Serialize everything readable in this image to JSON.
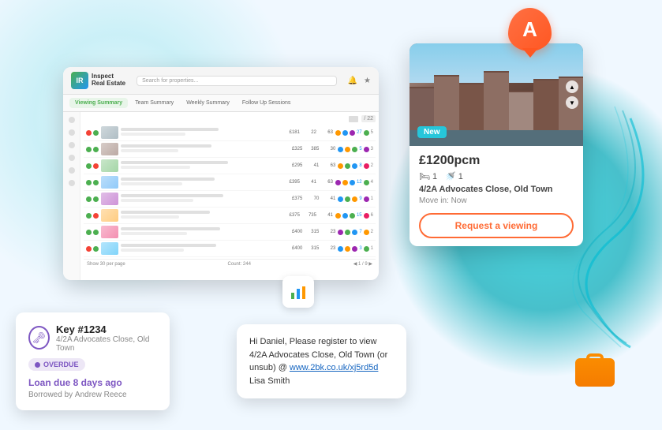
{
  "app": {
    "title": "Inspect Real Estate",
    "search_placeholder": "Search for properties..."
  },
  "crm": {
    "tabs": [
      {
        "label": "Viewing Summary",
        "active": true
      },
      {
        "label": "Team Summary"
      },
      {
        "label": "Weekly Summary"
      },
      {
        "label": "Follow Up Sessions"
      }
    ],
    "rows": [
      {
        "price": "£181",
        "nums": [
          "22",
          "63"
        ],
        "img": "img1"
      },
      {
        "price": "£325",
        "nums": [
          "385",
          "30"
        ],
        "img": "img2"
      },
      {
        "price": "£295",
        "nums": [
          "41",
          "63"
        ],
        "img": "img3"
      },
      {
        "price": "£395",
        "nums": [
          "41",
          "63"
        ],
        "img": "img4"
      },
      {
        "price": "£375",
        "nums": [
          "70",
          "41"
        ],
        "img": "img5"
      },
      {
        "price": "£375",
        "nums": [
          "735",
          "41"
        ],
        "img": "img6"
      },
      {
        "price": "£400",
        "nums": [
          "315",
          "23"
        ],
        "img": "img7"
      },
      {
        "price": "£400",
        "nums": [
          "315",
          "23"
        ],
        "img": "img8"
      }
    ],
    "pagination": {
      "show": "Show 30 per page",
      "count": "Count: 244",
      "pages": "1 / 9"
    }
  },
  "property": {
    "badge": "New",
    "price": "£1200pcm",
    "beds": "1",
    "baths": "1",
    "address": "4/2A Advocates Close, Old Town",
    "movein_label": "Move in:",
    "movein_value": "Now",
    "cta_button": "Request a viewing"
  },
  "key_card": {
    "key_number": "Key #1234",
    "location": "4/2A Advocates Close, Old Town",
    "badge": "OVERDUE",
    "loan_due": "Loan due 8 days ago",
    "borrowed_label": "Borrowed by",
    "borrowed_by": "Andrew Reece"
  },
  "sms_card": {
    "message_start": "Hi Daniel, Please register to view 4/2A Advocates Close, Old Town (or unsub) @ ",
    "link_text": "www.2bk.co.uk/xj5rd5d",
    "message_end": "\nLisa Smith"
  },
  "icons": {
    "app_letter": "A",
    "key": "🗝",
    "bed": "🛏",
    "bath": "🚿",
    "overdue_dot": "●"
  }
}
